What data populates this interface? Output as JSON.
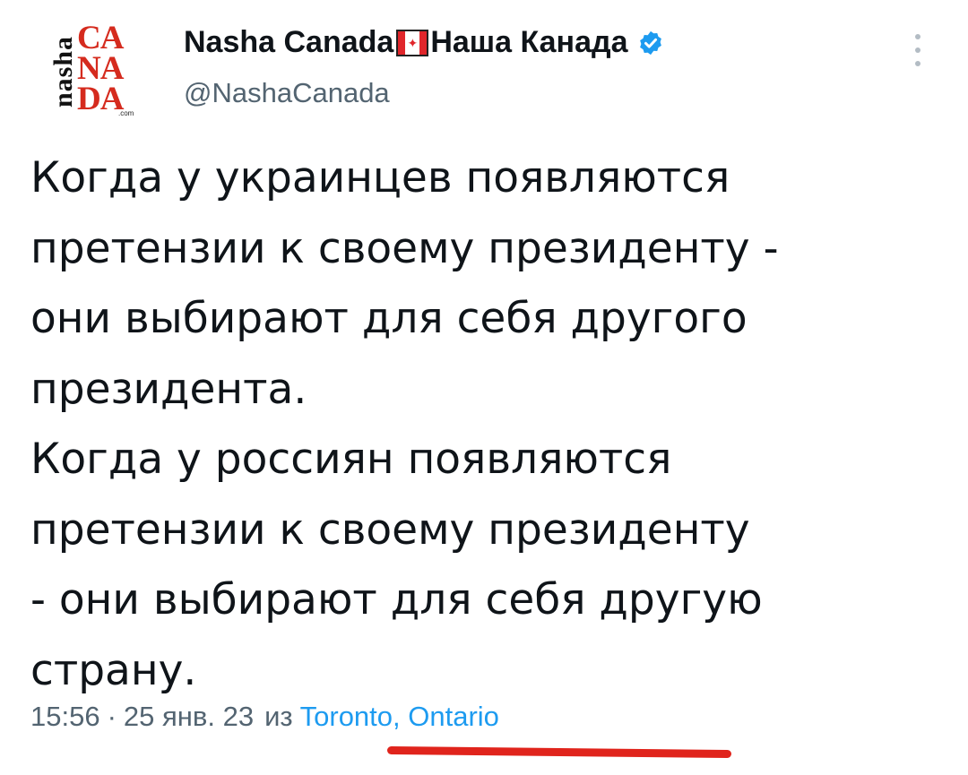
{
  "account": {
    "avatar_vertical_text": "nasha",
    "avatar_letters": [
      "CA",
      "NA",
      "DA"
    ],
    "avatar_small_text": ".com",
    "name_part1": "Nasha Canada",
    "name_part2": "Наша Канада",
    "flag_icon": "canada-flag-icon",
    "verified_icon": "verified-badge-icon",
    "handle": "@NashaCanada"
  },
  "tweet": {
    "lines": [
      "Когда у украинцев появляются",
      "претензии к своему президенту -",
      "они выбирают для себя другого",
      "президента.",
      "Когда у россиян появляются",
      "претензии к своему президенту",
      "- они выбирают для себя другую",
      "страну."
    ]
  },
  "meta": {
    "time": "15:56",
    "separator": "·",
    "date": "25 янв. 23",
    "from_label": "из",
    "location": "Toronto, Ontario"
  },
  "colors": {
    "text": "#0f1419",
    "secondary": "#536471",
    "link": "#1d9bf0",
    "brand_red": "#d52b1e",
    "verified": "#1d9bf0",
    "underline_annotation": "#e0241c"
  }
}
